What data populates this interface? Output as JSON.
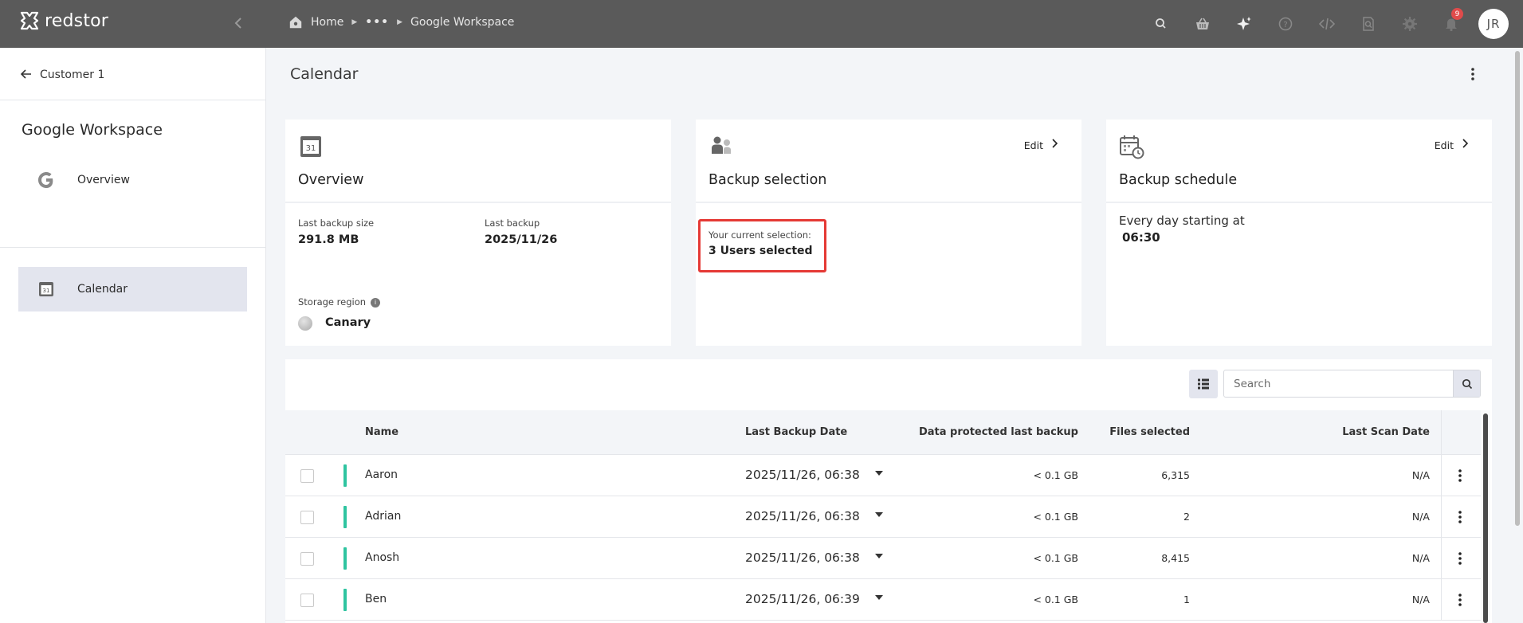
{
  "app": {
    "brand": "redstor",
    "user_initials": "JR",
    "notification_count": "9"
  },
  "breadcrumb": {
    "home": "Home",
    "ellipsis": "•••",
    "current": "Google Workspace"
  },
  "sidebar": {
    "back_label": "Customer 1",
    "title": "Google Workspace",
    "items": [
      {
        "label": "Overview",
        "icon": "google-g-icon",
        "active": false
      },
      {
        "label": "Calendar",
        "icon": "calendar-icon",
        "active": true
      }
    ]
  },
  "page": {
    "title": "Calendar"
  },
  "overview_card": {
    "title": "Overview",
    "icon_text": "31",
    "last_backup_size_label": "Last backup size",
    "last_backup_size": "291.8 MB",
    "last_backup_label": "Last backup",
    "last_backup": "2025/11/26",
    "storage_region_label": "Storage region",
    "storage_region": "Canary",
    "info_glyph": "i"
  },
  "selection_card": {
    "title": "Backup selection",
    "edit_label": "Edit",
    "current_label": "Your current selection:",
    "current_value": "3 Users selected"
  },
  "schedule_card": {
    "title": "Backup schedule",
    "edit_label": "Edit",
    "text": "Every day starting at",
    "time": "06:30"
  },
  "table": {
    "search_placeholder": "Search",
    "columns": {
      "name": "Name",
      "last_backup_date": "Last Backup Date",
      "data_protected": "Data protected last backup",
      "files_selected": "Files selected",
      "last_scan_date": "Last Scan Date"
    },
    "rows": [
      {
        "name": "Aaron",
        "date": "2025/11/26, 06:38",
        "protected": "< 0.1 GB",
        "files": "6,315",
        "scan": "N/A"
      },
      {
        "name": "Adrian",
        "date": "2025/11/26, 06:38",
        "protected": "< 0.1 GB",
        "files": "2",
        "scan": "N/A"
      },
      {
        "name": "Anosh",
        "date": "2025/11/26, 06:38",
        "protected": "< 0.1 GB",
        "files": "8,415",
        "scan": "N/A"
      },
      {
        "name": "Ben",
        "date": "2025/11/26, 06:39",
        "protected": "< 0.1 GB",
        "files": "1",
        "scan": "N/A"
      }
    ]
  },
  "colors": {
    "topbar": "#5a5a5a",
    "status_ok": "#2ec4a0",
    "highlight": "#e53935",
    "active_item": "#e3e5ee"
  }
}
